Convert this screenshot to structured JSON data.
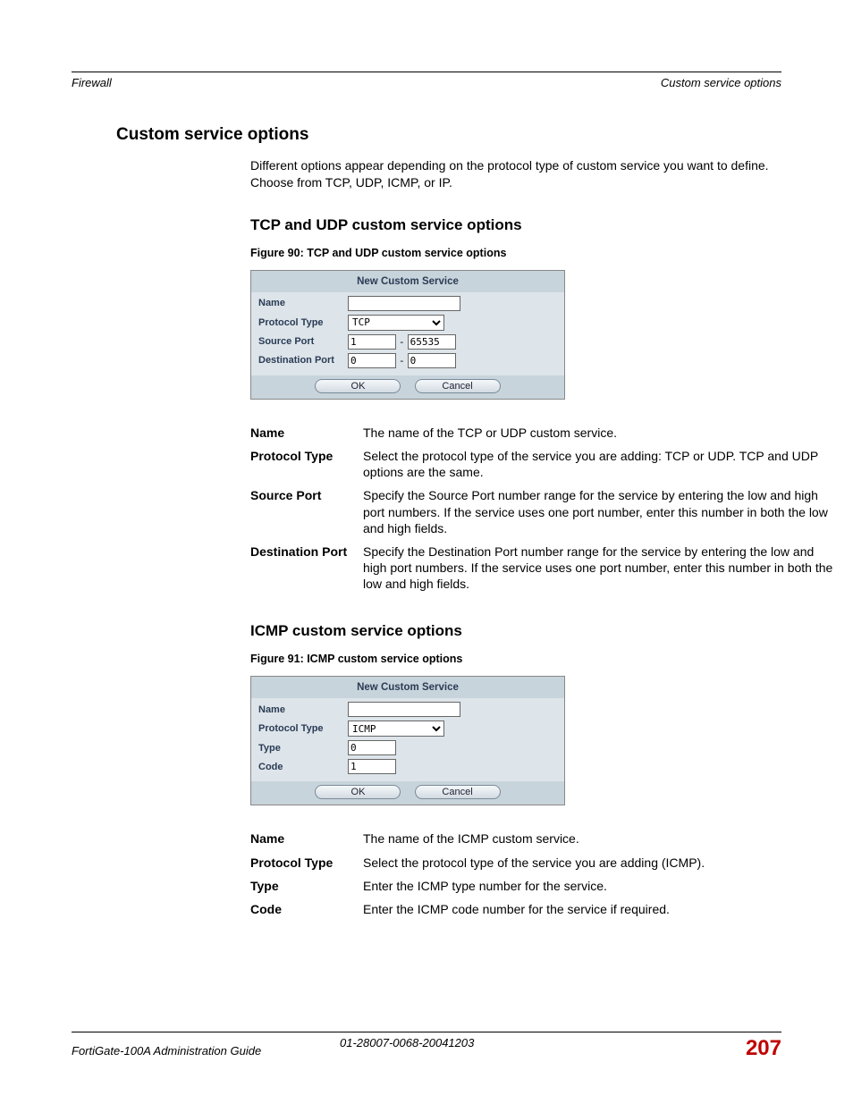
{
  "header": {
    "left": "Firewall",
    "right": "Custom service options"
  },
  "section_title": "Custom service options",
  "intro": "Different options appear depending on the protocol type of custom service you want to define. Choose from TCP, UDP, ICMP, or IP.",
  "tcp": {
    "heading": "TCP and UDP custom service options",
    "figcap": "Figure 90: TCP and UDP custom service options",
    "form": {
      "title": "New Custom Service",
      "labels": {
        "name": "Name",
        "ptype": "Protocol Type",
        "sport": "Source Port",
        "dport": "Destination Port"
      },
      "values": {
        "name": "",
        "ptype": "TCP",
        "sport_lo": "1",
        "sport_hi": "65535",
        "dport_lo": "0",
        "dport_hi": "0"
      },
      "ok": "OK",
      "cancel": "Cancel"
    },
    "defs": [
      {
        "term": "Name",
        "desc": "The name of the TCP or UDP custom service."
      },
      {
        "term": "Protocol Type",
        "desc": "Select the protocol type of the service you are adding: TCP or UDP. TCP and UDP options are the same."
      },
      {
        "term": "Source Port",
        "desc": "Specify the Source Port number range for the service by entering the low and high port numbers. If the service uses one port number, enter this number in both the low and high fields."
      },
      {
        "term": "Destination Port",
        "desc": "Specify the Destination Port number range for the service by entering the low and high port numbers. If the service uses one port number, enter this number in both the low and high fields."
      }
    ]
  },
  "icmp": {
    "heading": "ICMP custom service options",
    "figcap": "Figure 91: ICMP custom service options",
    "form": {
      "title": "New Custom Service",
      "labels": {
        "name": "Name",
        "ptype": "Protocol Type",
        "type": "Type",
        "code": "Code"
      },
      "values": {
        "name": "",
        "ptype": "ICMP",
        "type": "0",
        "code": "1"
      },
      "ok": "OK",
      "cancel": "Cancel"
    },
    "defs": [
      {
        "term": "Name",
        "desc": "The name of the ICMP custom service."
      },
      {
        "term": "Protocol Type",
        "desc": "Select the protocol type of the service you are adding (ICMP)."
      },
      {
        "term": "Type",
        "desc": "Enter the ICMP type number for the service."
      },
      {
        "term": "Code",
        "desc": "Enter the ICMP code number for the service if required."
      }
    ]
  },
  "footer": {
    "left": "FortiGate-100A Administration Guide",
    "mid": "01-28007-0068-20041203",
    "page": "207"
  }
}
